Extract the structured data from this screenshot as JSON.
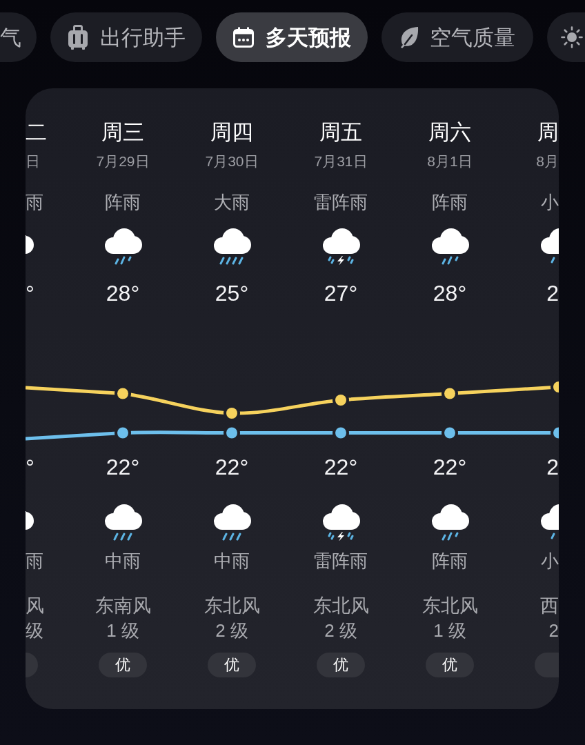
{
  "tabs": [
    {
      "label": "气",
      "kind": "plain",
      "selected": false
    },
    {
      "label": "出行助手",
      "kind": "suitcase",
      "selected": false
    },
    {
      "label": "多天预报",
      "kind": "calendar",
      "selected": true
    },
    {
      "label": "空气质量",
      "kind": "leaf",
      "selected": false
    },
    {
      "kind": "sun",
      "selected": false
    }
  ],
  "forecast": {
    "days": [
      {
        "kind": "cut-left",
        "weekday": "二",
        "date": "日",
        "day_weather": {
          "text": "雨"
        },
        "high": "°",
        "low": "°",
        "night_weather": {
          "text": "雨"
        },
        "wind": "风",
        "wind_level": "级"
      },
      {
        "kind": "full",
        "weekday": "周三",
        "date": "7月29日",
        "day_weather": {
          "text": "阵雨",
          "kind": "shower"
        },
        "high": "28°",
        "low": "22°",
        "night_weather": {
          "text": "中雨",
          "kind": "rain"
        },
        "wind": "东南风",
        "wind_level": "1 级",
        "aqi": "优"
      },
      {
        "kind": "full",
        "weekday": "周四",
        "date": "7月30日",
        "day_weather": {
          "text": "大雨",
          "kind": "heavy-rain"
        },
        "high": "25°",
        "low": "22°",
        "night_weather": {
          "text": "中雨",
          "kind": "rain"
        },
        "wind": "东北风",
        "wind_level": "2 级",
        "aqi": "优"
      },
      {
        "kind": "full",
        "weekday": "周五",
        "date": "7月31日",
        "day_weather": {
          "text": "雷阵雨",
          "kind": "thunder-shower"
        },
        "high": "27°",
        "low": "22°",
        "night_weather": {
          "text": "雷阵雨",
          "kind": "thunder-shower"
        },
        "wind": "东北风",
        "wind_level": "2 级",
        "aqi": "优"
      },
      {
        "kind": "full",
        "weekday": "周六",
        "date": "8月1日",
        "day_weather": {
          "text": "阵雨",
          "kind": "shower"
        },
        "high": "28°",
        "low": "22°",
        "night_weather": {
          "text": "阵雨",
          "kind": "shower"
        },
        "wind": "东北风",
        "wind_level": "1 级",
        "aqi": "优"
      },
      {
        "kind": "cut-right",
        "weekday": "周",
        "date": "8月",
        "day_weather": {
          "text": "小",
          "kind": "light-rain"
        },
        "high": "2",
        "low": "2",
        "night_weather": {
          "text": "小",
          "kind": "light-rain"
        },
        "wind": "西",
        "wind_level": "2"
      }
    ]
  }
}
